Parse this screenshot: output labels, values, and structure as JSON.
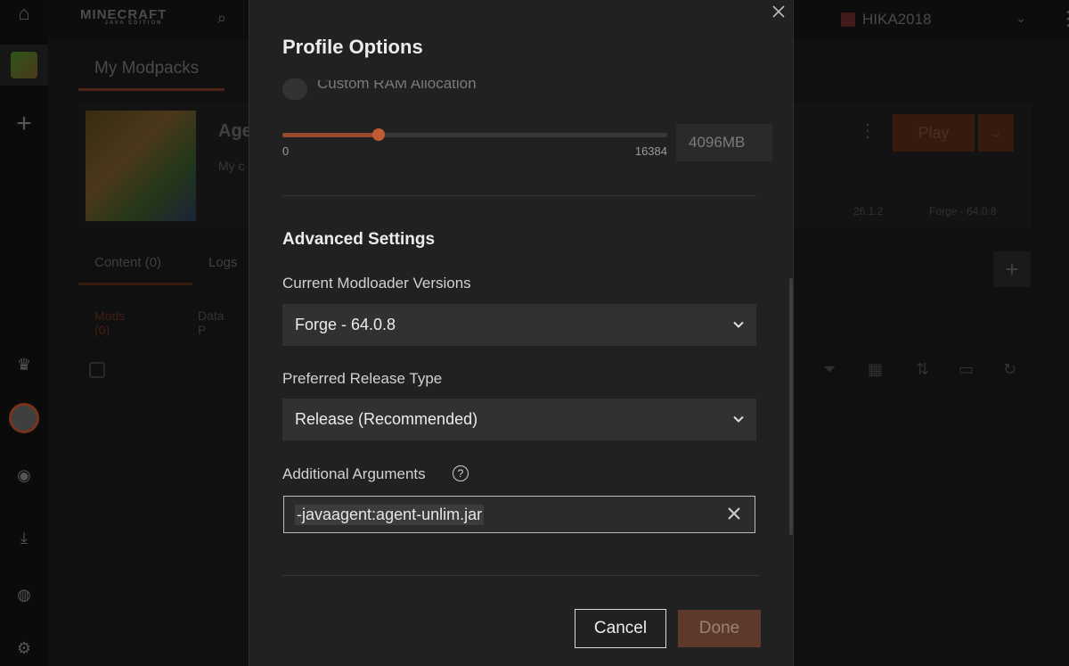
{
  "app": {
    "brand": "MINECRAFT",
    "brand_sub": "JAVA EDITION",
    "username": "HIKA2018",
    "tab_my_modpacks": "My Modpacks",
    "pack": {
      "name": "Age",
      "desc": "My c",
      "play_label": "Play",
      "meta_version": "26.1.2",
      "meta_loader": "Forge - 64.0.8"
    },
    "content_tabs": {
      "content": "Content (0)",
      "logs": "Logs"
    },
    "filters": {
      "mods": "Mods (0)",
      "data_packs": "Data P"
    }
  },
  "modal": {
    "title": "Profile Options",
    "ram": {
      "toggle_label": "Custom RAM Allocation",
      "min_label": "0",
      "max_label": "16384",
      "min": 0,
      "max": 16384,
      "value": 4096,
      "value_display": "4096MB"
    },
    "advanced": {
      "title": "Advanced Settings",
      "modloader_label": "Current Modloader Versions",
      "modloader_value": "Forge - 64.0.8",
      "release_label": "Preferred Release Type",
      "release_value": "Release (Recommended)",
      "args_label": "Additional Arguments",
      "args_value": "-javaagent:agent-unlim.jar"
    },
    "buttons": {
      "cancel": "Cancel",
      "done": "Done"
    }
  },
  "colors": {
    "accent": "#c15a35",
    "done_bg": "#5d3a2c",
    "modal_bg": "#212121"
  }
}
